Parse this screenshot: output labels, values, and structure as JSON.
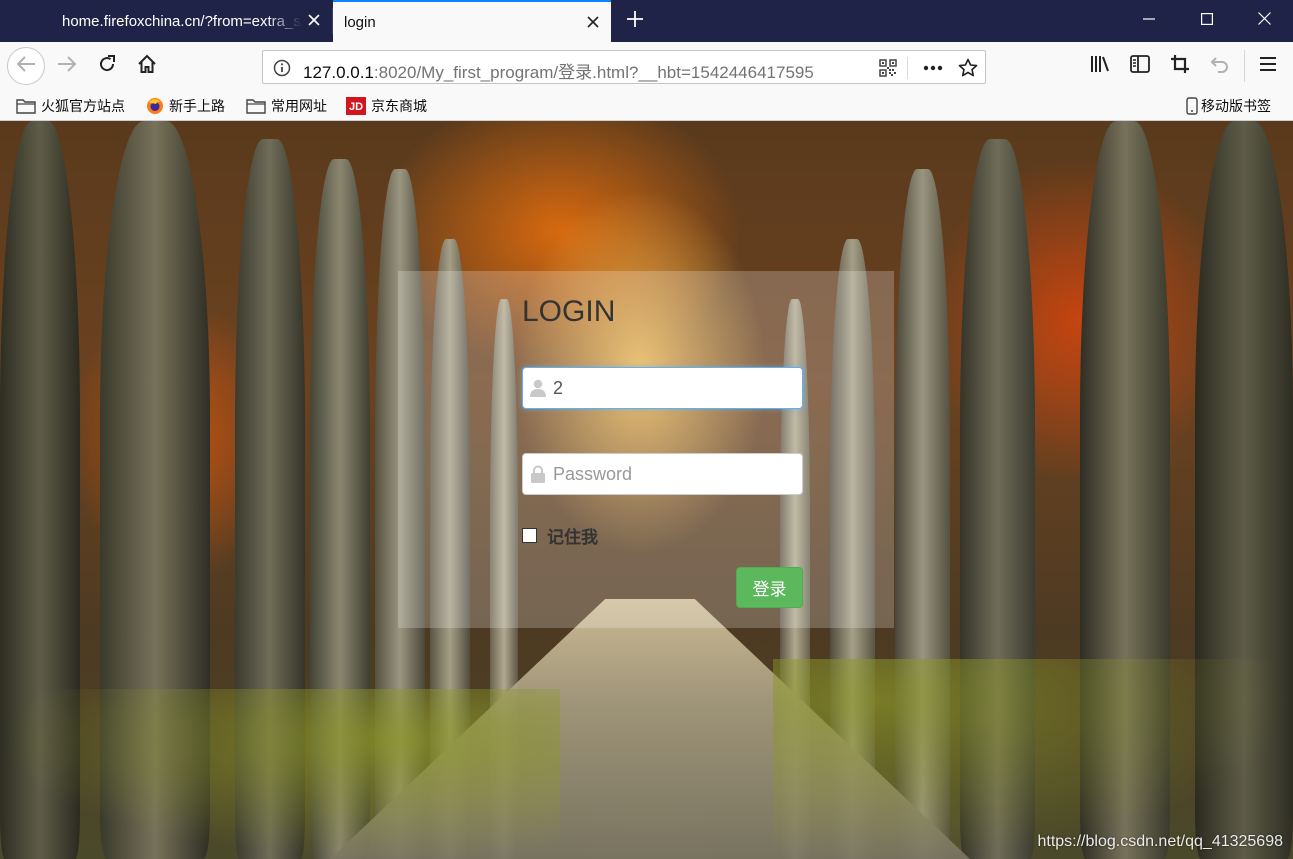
{
  "window": {
    "active_tab": {
      "title": "login",
      "close_icon": "close-icon"
    },
    "inactive_tab": {
      "title": "home.firefoxchina.cn/?from=extra_start",
      "close_icon": "close-icon"
    },
    "new_tab_icon": "plus-icon",
    "controls": [
      "minimize-icon",
      "maximize-icon",
      "close-icon"
    ]
  },
  "navbar": {
    "url_host": "127.0.0.1",
    "url_rest": ":8020/My_first_program/登录.html?__hbt=1542446417595",
    "icons": [
      "back-icon",
      "forward-icon",
      "reload-icon",
      "home-icon",
      "info-icon",
      "qr-code-icon",
      "more-icon",
      "bookmark-star-icon",
      "library-icon",
      "sidebar-icon",
      "screenshot-icon",
      "undo-icon",
      "menu-icon"
    ]
  },
  "bookmarks": {
    "items": [
      {
        "label": "火狐官方站点",
        "icon": "folder-icon"
      },
      {
        "label": "新手上路",
        "icon": "firefox-icon"
      },
      {
        "label": "常用网址",
        "icon": "folder-icon"
      },
      {
        "label": "京东商城",
        "icon": "jd-icon"
      }
    ],
    "mobile": {
      "label": "移动版书签",
      "icon": "mobile-icon"
    }
  },
  "login": {
    "title": "LOGIN",
    "username_value": "2",
    "username_icon": "user-icon",
    "password_placeholder": "Password",
    "password_icon": "lock-icon",
    "remember_label": "记住我",
    "submit_label": "登录",
    "submit_color": "#5cb85c"
  },
  "watermark": "https://blog.csdn.net/qq_41325698",
  "colors": {
    "titlebar": "#1f2347",
    "tab_accent": "#0a84ff",
    "toolbar": "#f9f9fa"
  }
}
